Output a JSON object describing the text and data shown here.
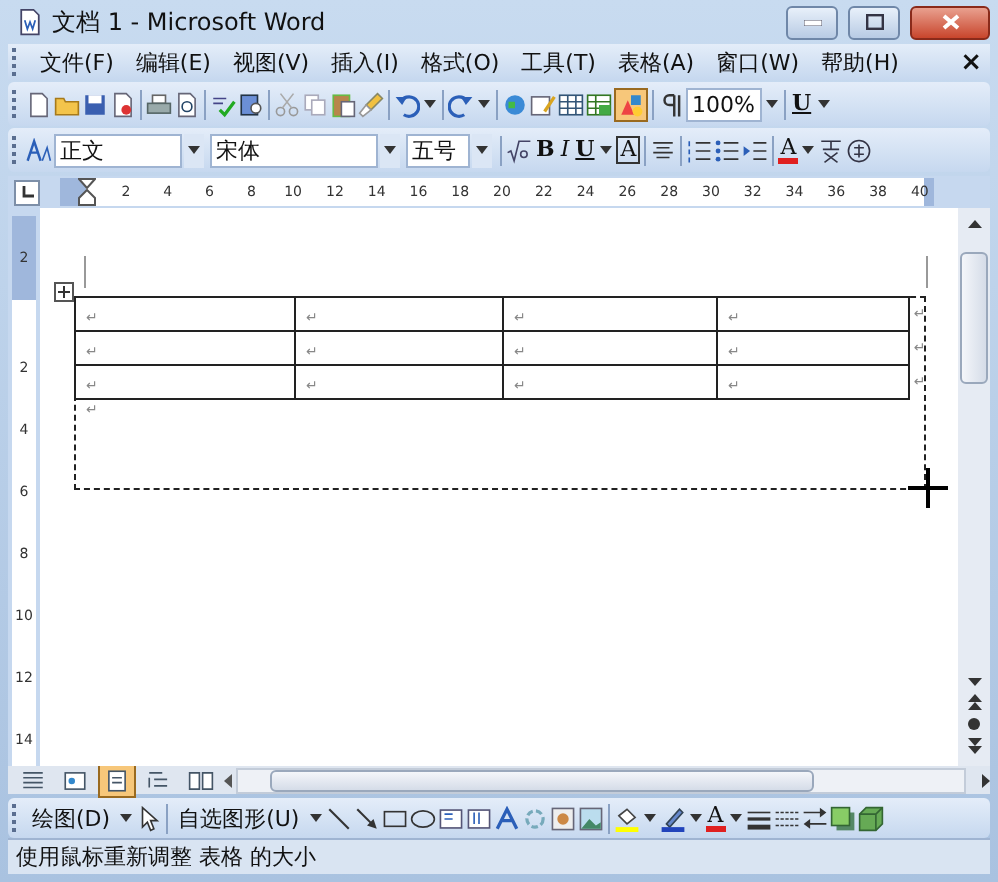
{
  "window": {
    "title": "文档 1 - Microsoft Word"
  },
  "menu": {
    "items": [
      {
        "label": "文件(F)"
      },
      {
        "label": "编辑(E)"
      },
      {
        "label": "视图(V)"
      },
      {
        "label": "插入(I)"
      },
      {
        "label": "格式(O)"
      },
      {
        "label": "工具(T)"
      },
      {
        "label": "表格(A)"
      },
      {
        "label": "窗口(W)"
      },
      {
        "label": "帮助(H)"
      }
    ],
    "close_glyph": "×"
  },
  "standard_toolbar": {
    "drawing_pressed": true,
    "zoom": "100%",
    "underline_char": "U"
  },
  "formatting_toolbar": {
    "style": "正文",
    "font": "宋体",
    "size": "五号",
    "bold": "B",
    "italic": "I",
    "underline": "U",
    "border_char": "A",
    "font_color_char": "A"
  },
  "ruler": {
    "horizontal_numbers": [
      "2",
      "4",
      "6",
      "8",
      "10",
      "12",
      "14",
      "16",
      "18",
      "20",
      "22",
      "24",
      "26",
      "28",
      "30",
      "32",
      "34",
      "36",
      "38",
      "40"
    ],
    "vertical_numbers": [
      "2",
      "2",
      "4",
      "6",
      "8",
      "10",
      "12",
      "14"
    ]
  },
  "document": {
    "table": {
      "rows": [
        [
          "↵",
          "↵",
          "↵",
          "↵"
        ],
        [
          "↵",
          "↵",
          "↵",
          "↵"
        ],
        [
          "↵",
          "↵",
          "↵",
          "↵"
        ]
      ],
      "row_end_marks": [
        "↵",
        "↵",
        "↵"
      ]
    },
    "paragraph_mark": "↵"
  },
  "view_buttons": [
    {
      "selected": false
    },
    {
      "selected": false
    },
    {
      "selected": true
    },
    {
      "selected": false
    },
    {
      "selected": false
    }
  ],
  "drawing_toolbar": {
    "draw_menu": {
      "label": "绘图(D)"
    },
    "autoshapes_menu": {
      "label": "自选图形(U)"
    },
    "font_color_char": "A"
  },
  "status_bar": {
    "text": "使用鼠标重新调整 表格 的大小"
  }
}
